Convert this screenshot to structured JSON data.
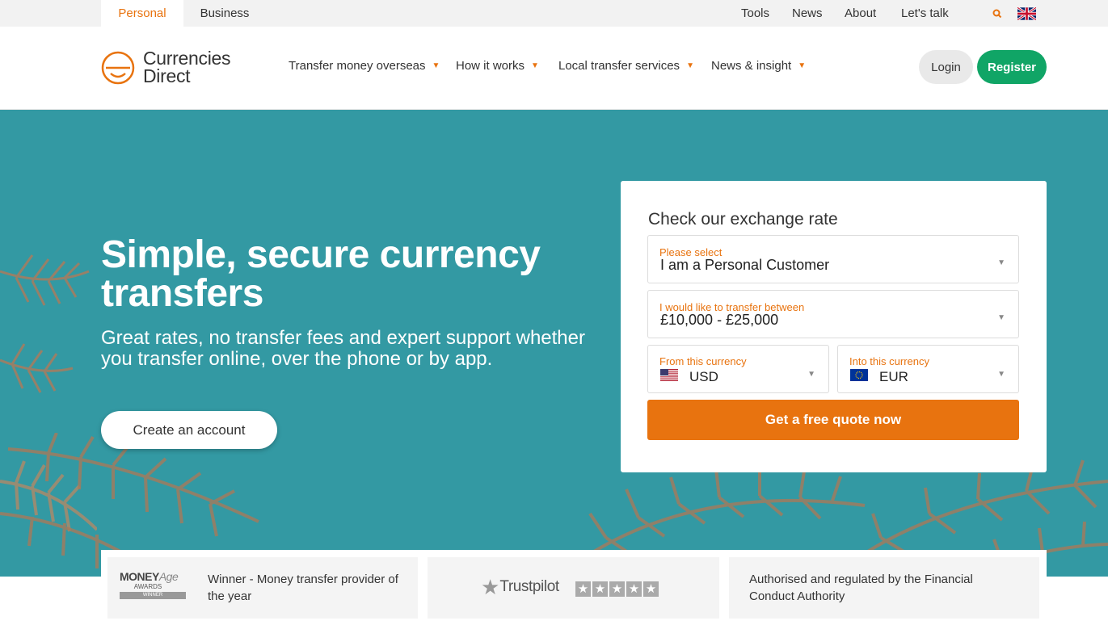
{
  "topbar": {
    "segments": [
      "Personal",
      "Business"
    ],
    "links": [
      "Tools",
      "News",
      "About",
      "Let's talk"
    ],
    "search_icon": "search-icon",
    "flag_icon": "uk-flag-icon"
  },
  "header": {
    "logo_text_1": "Currencies",
    "logo_text_2": "Direct",
    "nav": [
      "Transfer money overseas",
      "How it works",
      "Local transfer services",
      "News & insight"
    ],
    "login": "Login",
    "register": "Register"
  },
  "hero": {
    "title": "Simple, secure currency transfers",
    "subtitle": "Great rates, no transfer fees and expert support whether you transfer online, over the phone or by app.",
    "cta": "Create an account"
  },
  "quote": {
    "title": "Check our exchange rate",
    "customer_label": "Please select",
    "customer_value": "I am a Personal Customer",
    "amount_label": "I would like to transfer between",
    "amount_value": "£10,000 - £25,000",
    "from_label": "From this currency",
    "from_value": "USD",
    "to_label": "Into this currency",
    "to_value": "EUR",
    "button": "Get a free quote now"
  },
  "trust": {
    "award_logo_line1": "MONEY",
    "award_logo_line1b": "Age",
    "award_logo_line2": "AWARDS",
    "award_logo_line3": "WINNER",
    "award_text": "Winner - Money transfer provider of the year",
    "trustpilot": "Trustpilot",
    "stars": 5,
    "fca_text": "Authorised and regulated by the Financial Conduct Authority"
  },
  "colors": {
    "accent": "#e8730f",
    "register": "#10a566",
    "hero_bg": "#3399a3"
  }
}
